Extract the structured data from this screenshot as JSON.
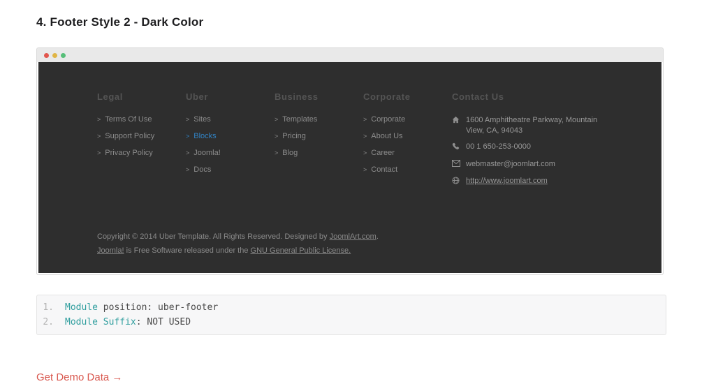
{
  "page": {
    "heading": "4. Footer Style 2 - Dark Color",
    "demo_link_label": "Get Demo Data",
    "demo_link_arrow": "→"
  },
  "window": {
    "controls": [
      {
        "name": "close-button",
        "color": "#e2574e"
      },
      {
        "name": "minimize-button",
        "color": "#e0b546"
      },
      {
        "name": "maximize-button",
        "color": "#57bf79"
      }
    ]
  },
  "footer": {
    "link_chevron": ">",
    "columns": [
      {
        "title": "Legal",
        "links": [
          {
            "label": "Terms Of Use"
          },
          {
            "label": "Support Policy"
          },
          {
            "label": "Privacy Policy"
          }
        ]
      },
      {
        "title": "Uber",
        "links": [
          {
            "label": "Sites"
          },
          {
            "label": "Blocks",
            "active": true
          },
          {
            "label": "Joomla!"
          },
          {
            "label": "Docs"
          }
        ]
      },
      {
        "title": "Business",
        "links": [
          {
            "label": "Templates"
          },
          {
            "label": "Pricing"
          },
          {
            "label": "Blog"
          }
        ]
      },
      {
        "title": "Corporate",
        "links": [
          {
            "label": "Corporate"
          },
          {
            "label": "About Us"
          },
          {
            "label": "Career"
          },
          {
            "label": "Contact"
          }
        ]
      }
    ],
    "contact": {
      "title": "Contact Us",
      "items": [
        {
          "icon": "home-icon",
          "text": "1600 Amphitheatre Parkway, Mountain View, CA, 94043"
        },
        {
          "icon": "phone-icon",
          "text": "00 1 650-253-0000"
        },
        {
          "icon": "envelope-icon",
          "text": "webmaster@joomlart.com"
        },
        {
          "icon": "globe-icon",
          "text": "http://www.joomlart.com",
          "underline": true
        }
      ]
    },
    "copyright": [
      [
        {
          "text": "Copyright © 2014 Uber Template. All Rights Reserved. Designed by "
        },
        {
          "text": "JoomlArt.com",
          "link": true
        },
        {
          "text": "."
        }
      ],
      [
        {
          "text": "Joomla!",
          "link": true
        },
        {
          "text": " is Free Software released under the "
        },
        {
          "text": "GNU General Public License.",
          "link": true
        }
      ]
    ]
  },
  "code_block": {
    "lines": [
      {
        "number": "1.",
        "segments": [
          {
            "text": "Module",
            "token": "keyword"
          },
          {
            "text": " position: uber-footer",
            "token": "plain"
          }
        ]
      },
      {
        "number": "2.",
        "segments": [
          {
            "text": "Module Suffix",
            "token": "keyword"
          },
          {
            "text": ": NOT USED",
            "token": "plain"
          }
        ]
      }
    ]
  },
  "colors": {
    "footer_bg": "#2e2e2e",
    "titlebar_bg": "#e9e9e9",
    "active_link_blue": "#3183c4",
    "code_keyword_teal": "#2f9e9e",
    "demo_link_red": "#d9584f"
  }
}
